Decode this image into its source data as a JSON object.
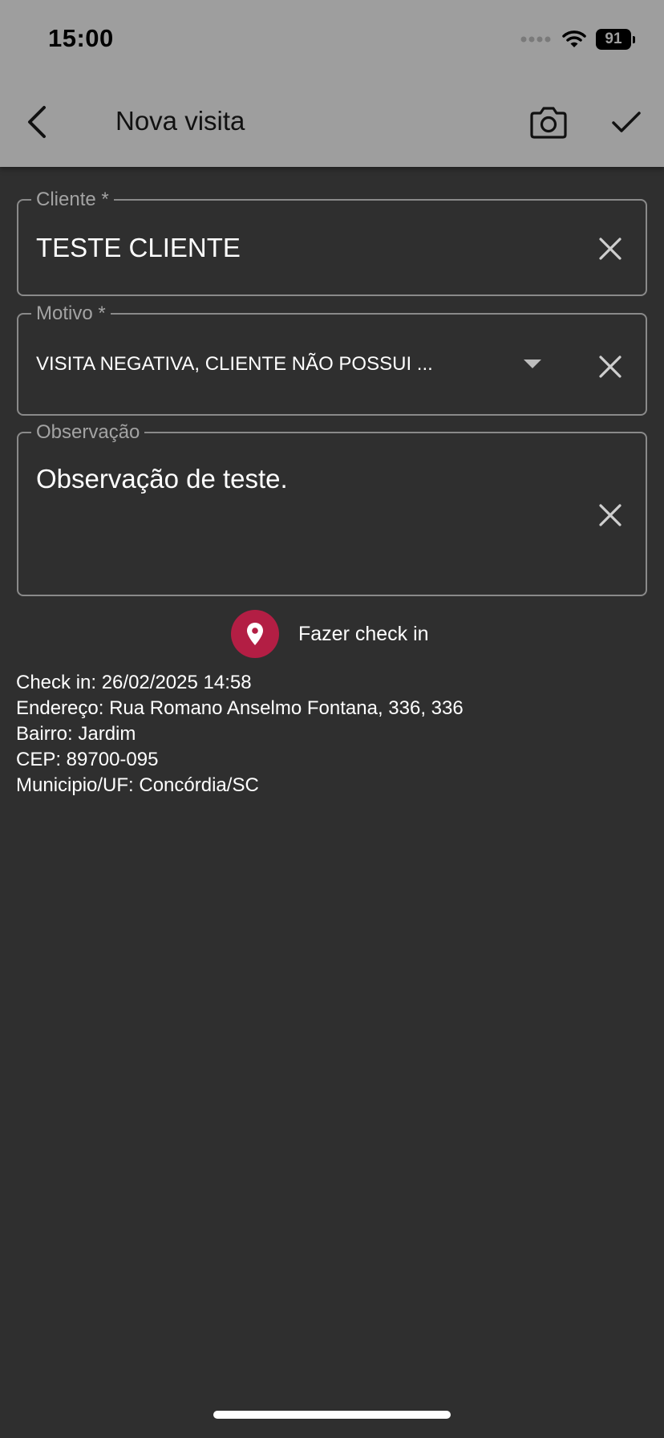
{
  "status_bar": {
    "time": "15:00",
    "battery": "91"
  },
  "header": {
    "title": "Nova visita"
  },
  "form": {
    "cliente": {
      "label": "Cliente *",
      "value": "TESTE CLIENTE"
    },
    "motivo": {
      "label": "Motivo *",
      "value": "VISITA NEGATIVA, CLIENTE NÃO POSSUI ..."
    },
    "observacao": {
      "label": "Observação",
      "value": "Observação de teste."
    }
  },
  "checkin": {
    "button_label": "Fazer check in",
    "details": [
      "Check in: 26/02/2025 14:58",
      "Endereço: Rua Romano Anselmo Fontana, 336, 336",
      "Bairro: Jardim",
      "CEP: 89700-095",
      "Municipio/UF: Concórdia/SC"
    ]
  },
  "colors": {
    "accent": "#b31e44",
    "app_bar": "#9e9e9e",
    "background": "#2f2f2f"
  },
  "icons": [
    "signal-icon",
    "wifi-icon",
    "battery-icon",
    "back-arrow-icon",
    "camera-icon",
    "checkmark-icon",
    "clear-icon",
    "dropdown-arrow-icon",
    "location-pin-icon"
  ]
}
